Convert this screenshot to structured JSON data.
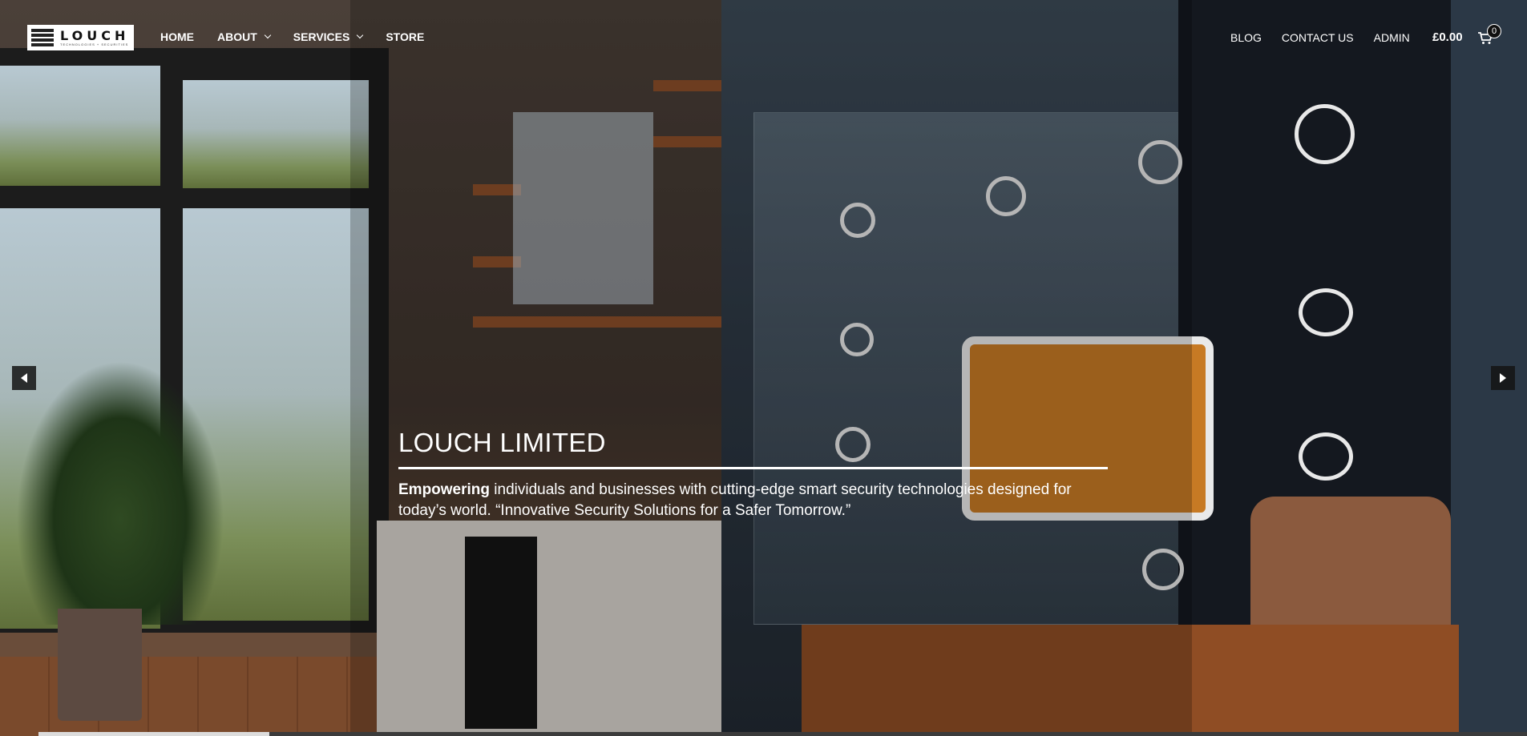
{
  "brand": {
    "logo_word": "LOUCH",
    "logo_sub": "TECHNOLOGIES + SECURITIES"
  },
  "nav": {
    "left": [
      {
        "label": "HOME",
        "dropdown": false
      },
      {
        "label": "ABOUT",
        "dropdown": true
      },
      {
        "label": "SERVICES",
        "dropdown": true
      },
      {
        "label": "STORE",
        "dropdown": false
      }
    ],
    "right": [
      {
        "label": "BLOG"
      },
      {
        "label": "CONTACT US"
      },
      {
        "label": "ADMIN"
      }
    ]
  },
  "cart": {
    "total": "£0.00",
    "count": "0",
    "icon": "basket-icon"
  },
  "slider": {
    "prev_icon": "arrow-left-icon",
    "next_icon": "arrow-right-icon",
    "title": "LOUCH LIMITED",
    "lead_bold": "Empowering",
    "text": " individuals and businesses with cutting-edge smart security technologies designed for today’s world. “Innovative Security Solutions for a Safer Tomorrow.”"
  }
}
